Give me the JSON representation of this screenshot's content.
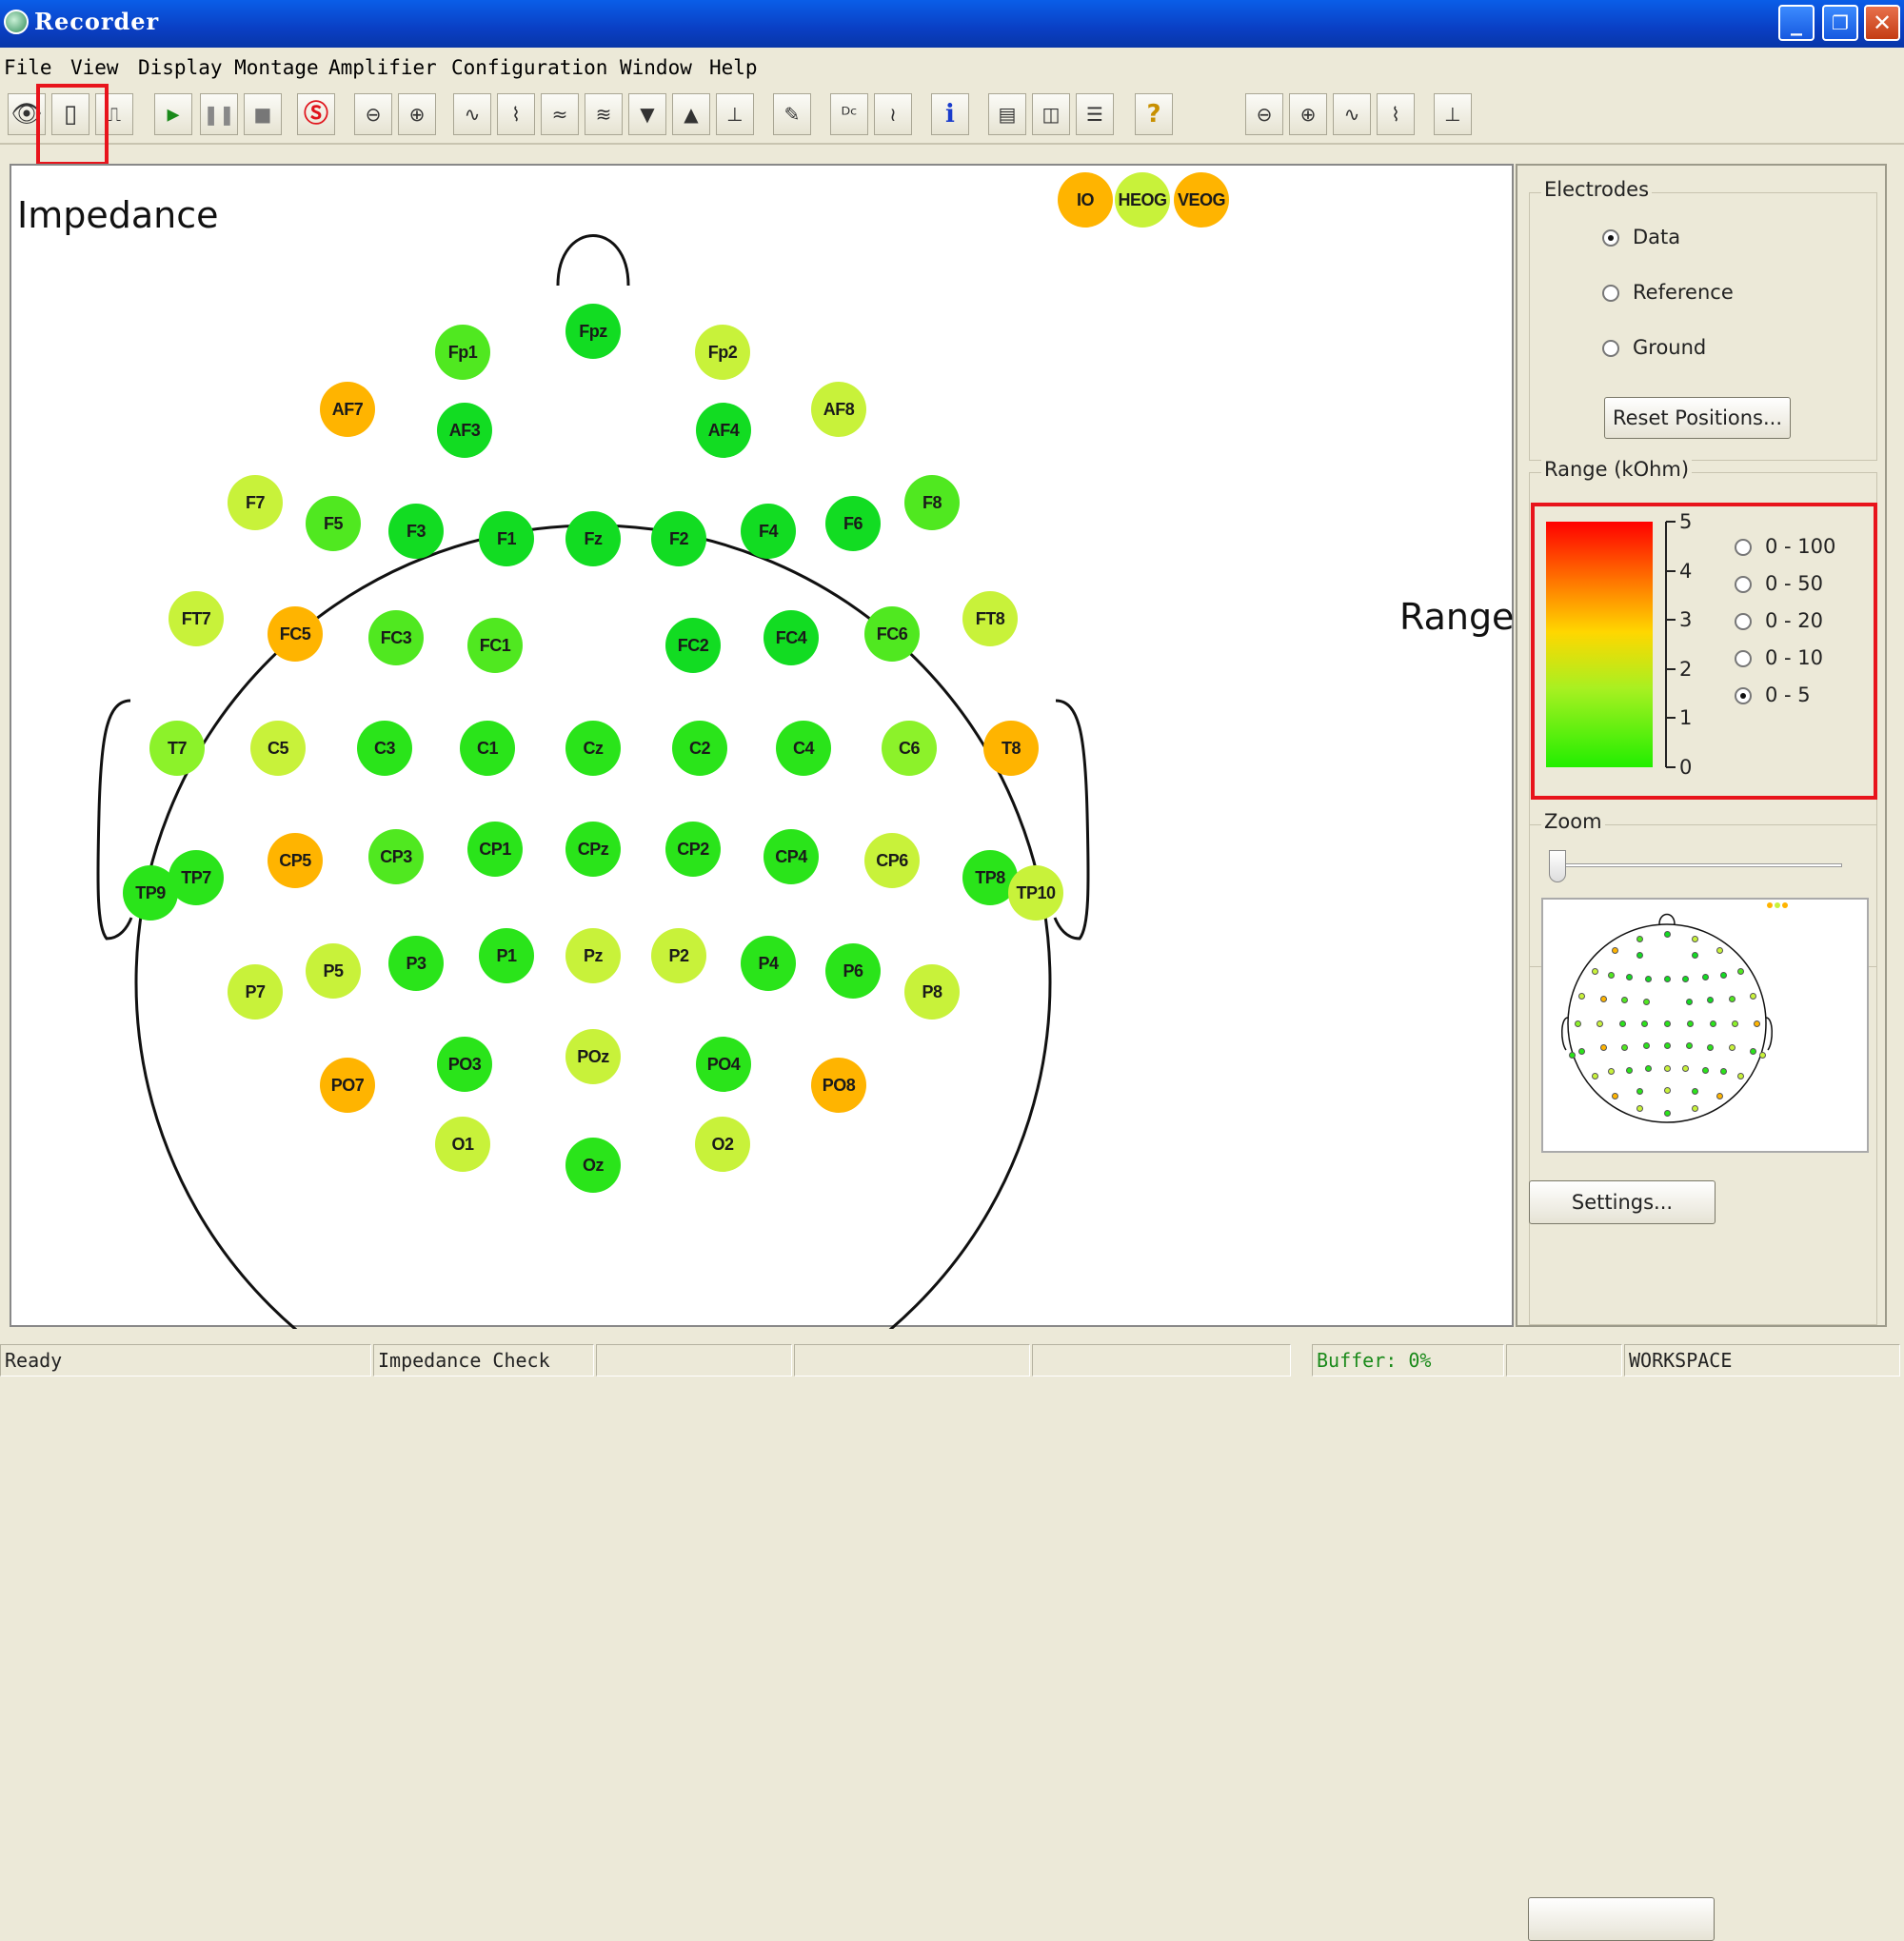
{
  "window": {
    "title": "Recorder"
  },
  "menu": [
    "File",
    "View",
    "Display Montage",
    "Amplifier",
    "Configuration",
    "Window",
    "Help"
  ],
  "toolbar": {
    "icons": [
      "eye-icon",
      "impedance-icon",
      "test-signal-icon",
      "play-icon",
      "pause-icon",
      "stop-icon",
      "stop-recording-icon",
      "zoom-out-icon",
      "zoom-in-icon",
      "wave-icon",
      "channel-icon",
      "baseline-icon",
      "filter-icon",
      "triangle-down-icon",
      "triangle-up-icon",
      "marker-icon",
      "pen-icon",
      "dc-icon",
      "waves-icon",
      "info-icon",
      "window-icon",
      "columns-icon",
      "rows-icon",
      "help-icon",
      "zoom-out-2-icon",
      "zoom-in-2-icon",
      "wave-2-icon",
      "channel-2-icon",
      "marker-2-icon"
    ]
  },
  "annotations": {
    "impedance": "Impedance",
    "range": "Range"
  },
  "colors": {
    "red": "#f03a0a",
    "orange": "#ffb400",
    "yellow": "#e8f000",
    "yellow_green": "#c8f23a",
    "light_green": "#8cf22a",
    "green": "#50e820",
    "bright_green": "#2ae41a",
    "deep_green": "#12dc22"
  },
  "electrodes": [
    {
      "label": "IO",
      "color": "#ffb400"
    },
    {
      "label": "HEOG",
      "color": "#c8f23a"
    },
    {
      "label": "VEOG",
      "color": "#ffb400"
    },
    {
      "label": "Fpz",
      "color": "#12dc22"
    },
    {
      "label": "Fp1",
      "color": "#50e820"
    },
    {
      "label": "Fp2",
      "color": "#c8f23a"
    },
    {
      "label": "AF7",
      "color": "#ffb400"
    },
    {
      "label": "AF3",
      "color": "#12dc22"
    },
    {
      "label": "AF4",
      "color": "#12dc22"
    },
    {
      "label": "AF8",
      "color": "#c8f23a"
    },
    {
      "label": "F7",
      "color": "#c8f23a"
    },
    {
      "label": "F5",
      "color": "#50e820"
    },
    {
      "label": "F3",
      "color": "#12dc22"
    },
    {
      "label": "F1",
      "color": "#12dc22"
    },
    {
      "label": "Fz",
      "color": "#12dc22"
    },
    {
      "label": "F2",
      "color": "#12dc22"
    },
    {
      "label": "F4",
      "color": "#12dc22"
    },
    {
      "label": "F6",
      "color": "#12dc22"
    },
    {
      "label": "F8",
      "color": "#50e820"
    },
    {
      "label": "FT7",
      "color": "#c8f23a"
    },
    {
      "label": "FC5",
      "color": "#ffb400"
    },
    {
      "label": "FC3",
      "color": "#50e820"
    },
    {
      "label": "FC1",
      "color": "#50e820"
    },
    {
      "label": "FC2",
      "color": "#12dc22"
    },
    {
      "label": "FC4",
      "color": "#12dc22"
    },
    {
      "label": "FC6",
      "color": "#50e820"
    },
    {
      "label": "FT8",
      "color": "#c8f23a"
    },
    {
      "label": "T7",
      "color": "#8cf22a"
    },
    {
      "label": "C5",
      "color": "#c8f23a"
    },
    {
      "label": "C3",
      "color": "#2ae41a"
    },
    {
      "label": "C1",
      "color": "#2ae41a"
    },
    {
      "label": "Cz",
      "color": "#2ae41a"
    },
    {
      "label": "C2",
      "color": "#2ae41a"
    },
    {
      "label": "C4",
      "color": "#2ae41a"
    },
    {
      "label": "C6",
      "color": "#8cf22a"
    },
    {
      "label": "T8",
      "color": "#ffb400"
    },
    {
      "label": "TP9",
      "color": "#2ae41a"
    },
    {
      "label": "TP7",
      "color": "#2ae41a"
    },
    {
      "label": "CP5",
      "color": "#ffb400"
    },
    {
      "label": "CP3",
      "color": "#50e820"
    },
    {
      "label": "CP1",
      "color": "#2ae41a"
    },
    {
      "label": "CPz",
      "color": "#2ae41a"
    },
    {
      "label": "CP2",
      "color": "#2ae41a"
    },
    {
      "label": "CP4",
      "color": "#2ae41a"
    },
    {
      "label": "CP6",
      "color": "#c8f23a"
    },
    {
      "label": "TP8",
      "color": "#2ae41a"
    },
    {
      "label": "TP10",
      "color": "#c8f23a"
    },
    {
      "label": "P7",
      "color": "#c8f23a"
    },
    {
      "label": "P5",
      "color": "#c8f23a"
    },
    {
      "label": "P3",
      "color": "#2ae41a"
    },
    {
      "label": "P1",
      "color": "#2ae41a"
    },
    {
      "label": "Pz",
      "color": "#c8f23a"
    },
    {
      "label": "P2",
      "color": "#c8f23a"
    },
    {
      "label": "P4",
      "color": "#2ae41a"
    },
    {
      "label": "P6",
      "color": "#2ae41a"
    },
    {
      "label": "P8",
      "color": "#c8f23a"
    },
    {
      "label": "PO7",
      "color": "#ffb400"
    },
    {
      "label": "PO3",
      "color": "#2ae41a"
    },
    {
      "label": "POz",
      "color": "#c8f23a"
    },
    {
      "label": "PO4",
      "color": "#2ae41a"
    },
    {
      "label": "PO8",
      "color": "#ffb400"
    },
    {
      "label": "O1",
      "color": "#c8f23a"
    },
    {
      "label": "Oz",
      "color": "#2ae41a"
    },
    {
      "label": "O2",
      "color": "#c8f23a"
    }
  ],
  "panel": {
    "electrodes_legend": "Electrodes",
    "electrode_options": [
      {
        "label": "Data",
        "checked": true
      },
      {
        "label": "Reference",
        "checked": false
      },
      {
        "label": "Ground",
        "checked": false
      }
    ],
    "reset_button": "Reset Positions...",
    "range_legend": "Range (kOhm)",
    "range_ticks": [
      "5",
      "4",
      "3",
      "2",
      "1",
      "0"
    ],
    "range_options": [
      {
        "label": "0 - 100",
        "checked": false
      },
      {
        "label": "0 - 50",
        "checked": false
      },
      {
        "label": "0 - 20",
        "checked": false
      },
      {
        "label": "0 - 10",
        "checked": false
      },
      {
        "label": "0 - 5",
        "checked": true
      }
    ],
    "zoom_legend": "Zoom",
    "zoom_level": 0,
    "settings_button": "Settings..."
  },
  "status": {
    "ready": "Ready",
    "mode": "Impedance Check",
    "buffer": "Buffer: 0%",
    "workspace": "WORKSPACE"
  }
}
